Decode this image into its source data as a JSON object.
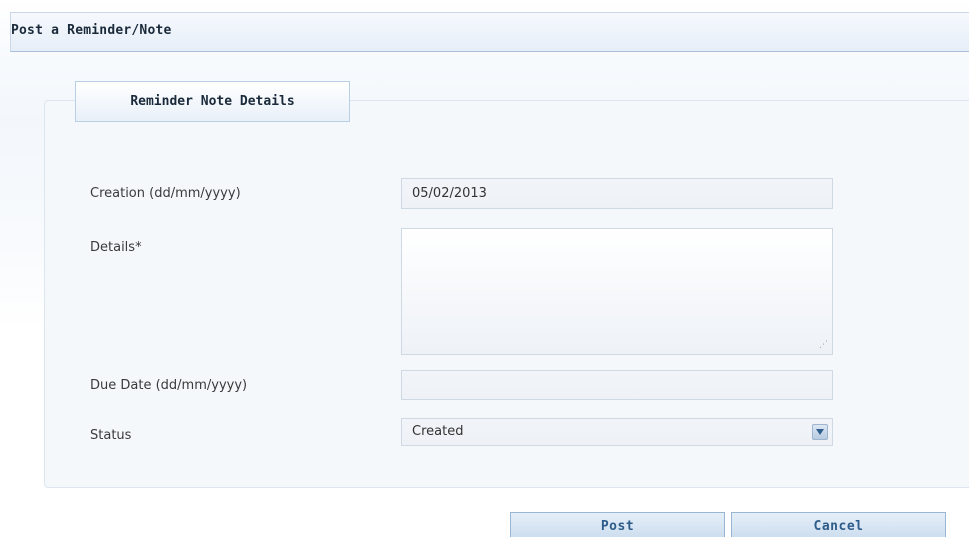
{
  "header": {
    "title": "Post a Reminder/Note"
  },
  "section": {
    "tab_label": "Reminder Note Details"
  },
  "form": {
    "creation": {
      "label": "Creation (dd/mm/yyyy)",
      "value": "05/02/2013"
    },
    "details": {
      "label": "Details*",
      "value": ""
    },
    "due_date": {
      "label": "Due Date (dd/mm/yyyy)",
      "value": ""
    },
    "status": {
      "label": "Status",
      "value": "Created"
    }
  },
  "actions": {
    "post_label": "Post",
    "cancel_label": "Cancel"
  },
  "icons": {
    "dropdown": "chevron-down-icon",
    "resize": "resize-grip-icon"
  },
  "colors": {
    "accent": "#2e5c8a",
    "panel_bg": "#f5f8fb",
    "border": "#98b5d4"
  }
}
